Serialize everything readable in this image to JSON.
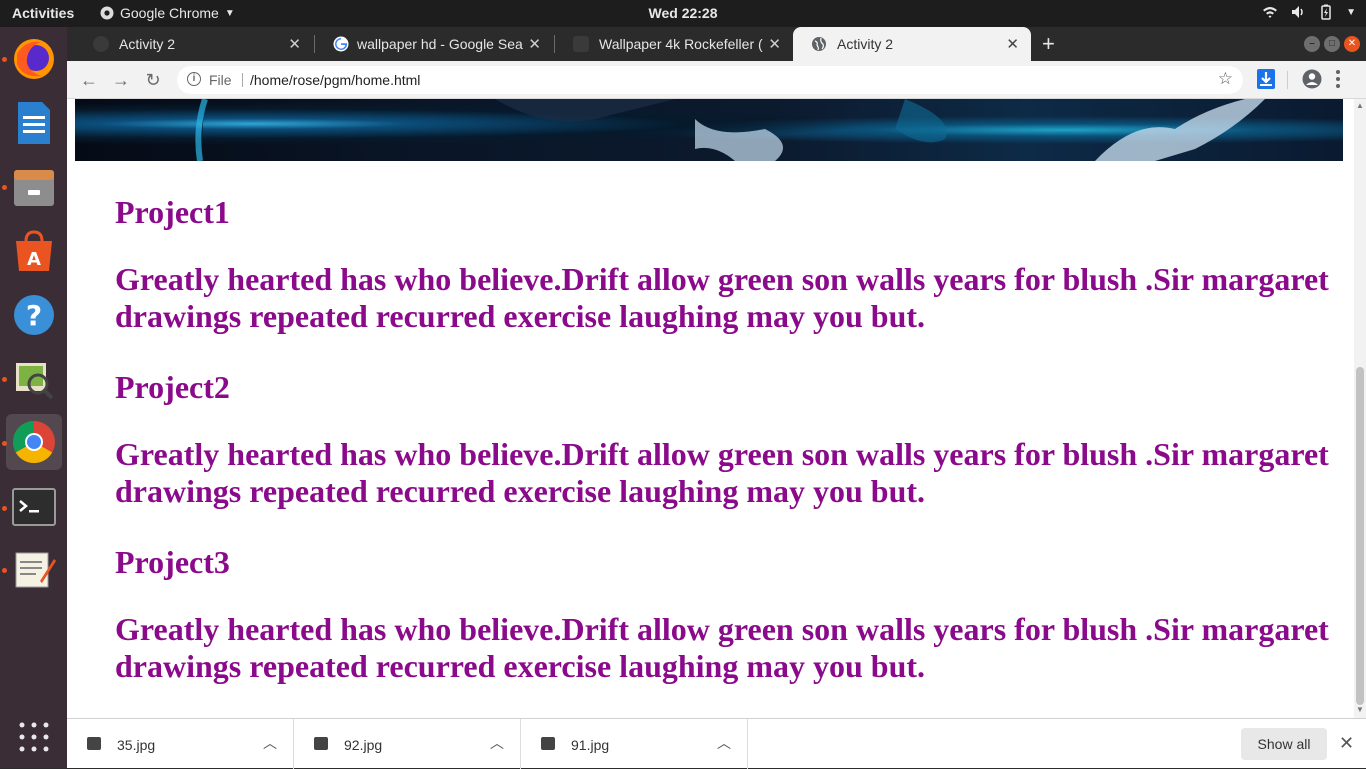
{
  "topbar": {
    "activities": "Activities",
    "app_name": "Google Chrome",
    "clock": "Wed 22:28"
  },
  "dock": {
    "items": [
      {
        "name": "firefox",
        "running": true
      },
      {
        "name": "libreoffice-writer",
        "running": false
      },
      {
        "name": "files",
        "running": true
      },
      {
        "name": "software-center",
        "running": false
      },
      {
        "name": "help",
        "running": false
      },
      {
        "name": "image-viewer",
        "running": true
      },
      {
        "name": "chrome",
        "running": true,
        "active": true
      },
      {
        "name": "terminal",
        "running": true
      },
      {
        "name": "text-editor",
        "running": true
      }
    ]
  },
  "browser": {
    "tabs": [
      {
        "title": "Activity 2",
        "active": false
      },
      {
        "title": "wallpaper hd - Google Sea",
        "active": false
      },
      {
        "title": "Wallpaper 4k Rockefeller (",
        "active": false
      },
      {
        "title": "Activity 2",
        "active": true
      }
    ],
    "omnibox": {
      "scheme": "File",
      "url": "/home/rose/pgm/home.html"
    }
  },
  "page": {
    "projects": [
      {
        "title": "Project1",
        "text": "Greatly hearted has who believe.Drift allow green son walls years for blush .Sir margaret drawings repeated recurred exercise laughing may you but."
      },
      {
        "title": "Project2",
        "text": "Greatly hearted has who believe.Drift allow green son walls years for blush .Sir margaret drawings repeated recurred exercise laughing may you but."
      },
      {
        "title": "Project3",
        "text": "Greatly hearted has who believe.Drift allow green son walls years for blush .Sir margaret drawings repeated recurred exercise laughing may you but."
      }
    ],
    "text_color": "#8b0a8b"
  },
  "downloads": {
    "items": [
      {
        "name": "35.jpg"
      },
      {
        "name": "92.jpg"
      },
      {
        "name": "91.jpg"
      }
    ],
    "show_all": "Show all"
  }
}
